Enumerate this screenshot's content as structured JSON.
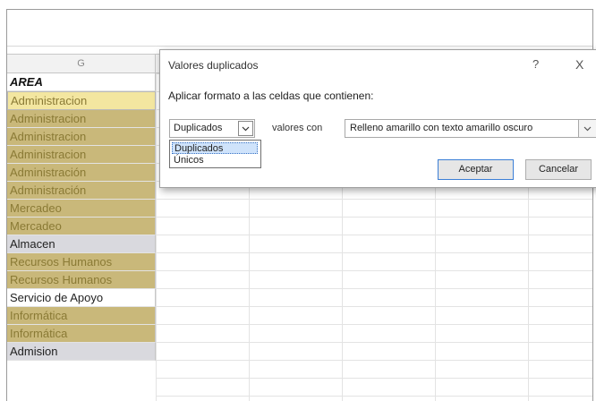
{
  "sheet": {
    "column_header": "G",
    "cells": [
      {
        "text": "AREA",
        "style": "header"
      },
      {
        "text": "Administracion",
        "style": "dup-first"
      },
      {
        "text": "Administracion",
        "style": "dup"
      },
      {
        "text": "Administracion",
        "style": "dup"
      },
      {
        "text": "Administracion",
        "style": "dup"
      },
      {
        "text": "Administración",
        "style": "dup"
      },
      {
        "text": "Administración",
        "style": "dup"
      },
      {
        "text": "Mercadeo",
        "style": "dup"
      },
      {
        "text": "Mercadeo",
        "style": "dup"
      },
      {
        "text": "Almacen",
        "style": "unique"
      },
      {
        "text": "Recursos Humanos",
        "style": "dup"
      },
      {
        "text": "Recursos Humanos",
        "style": "dup"
      },
      {
        "text": "Servicio de Apoyo",
        "style": "plain"
      },
      {
        "text": "Informática",
        "style": "dup"
      },
      {
        "text": "Informática",
        "style": "dup"
      },
      {
        "text": "Admision",
        "style": "unique"
      }
    ]
  },
  "dialog": {
    "title": "Valores duplicados",
    "help": "?",
    "close": "X",
    "instruction": "Aplicar formato a las celdas que contienen:",
    "type_select": {
      "value": "Duplicados",
      "options": [
        "Duplicados",
        "Únicos"
      ]
    },
    "connector_label": "valores con",
    "format_select": {
      "value": "Relleno amarillo con texto amarillo oscuro"
    },
    "ok_label": "Aceptar",
    "cancel_label": "Cancelar"
  },
  "colors": {
    "duplicate_fill": "#c9b87a",
    "duplicate_text": "#8a7a35",
    "selected_option": "#cfe3fb"
  }
}
